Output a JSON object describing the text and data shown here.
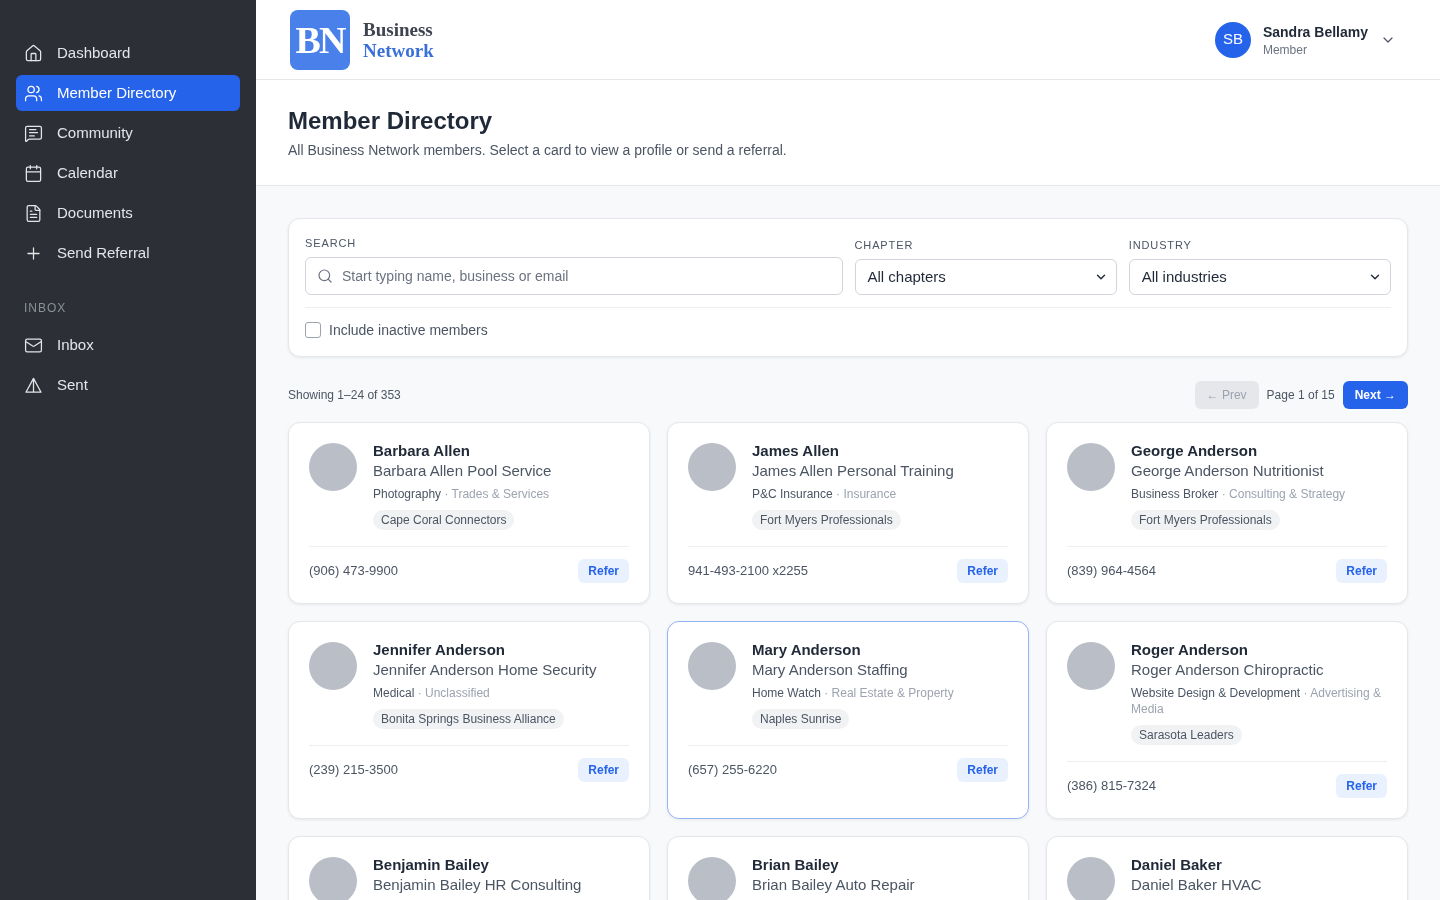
{
  "sidebar": {
    "items": [
      {
        "label": "Dashboard",
        "selected": false
      },
      {
        "label": "Member Directory",
        "selected": true
      },
      {
        "label": "Community",
        "selected": false
      },
      {
        "label": "Calendar",
        "selected": false
      },
      {
        "label": "Documents",
        "selected": false
      },
      {
        "label": "Send Referral",
        "selected": false
      }
    ],
    "section": {
      "label": "INBOX",
      "items": [
        {
          "label": "Inbox",
          "selected": false
        },
        {
          "label": "Sent",
          "selected": false
        }
      ]
    }
  },
  "header": {
    "logo": {
      "mark": "BN",
      "line_1": "Business",
      "line_2": "Network"
    },
    "user": {
      "initials": "SB",
      "name": "Sandra Bellamy",
      "role": "Member"
    }
  },
  "page_header": {
    "title": "Member Directory",
    "subtitle": "All Business Network members. Select a card to view a profile or send a referral."
  },
  "filters": {
    "search": {
      "label": "SEARCH",
      "placeholder": "Start typing name, business or email"
    },
    "chapter": {
      "label": "CHAPTER",
      "value": "All chapters"
    },
    "industry": {
      "label": "INDUSTRY",
      "value": "All industries"
    },
    "include_inactive": {
      "label": "Include inactive members",
      "checked": false
    }
  },
  "results": {
    "summary": "Showing 1–24 of 353",
    "prev": {
      "label": "← Prev",
      "disabled": true
    },
    "page": "Page 1 of 15",
    "next": {
      "label": "Next →",
      "disabled": false
    }
  },
  "members": [
    {
      "name": "Barbara Allen",
      "business": "Barbara Allen Pool Service",
      "category": "Photography",
      "sector": "· Trades & Services",
      "chapter": "Cape Coral Connectors",
      "phone": "(906) 473-9900",
      "action": "Refer",
      "selected": false
    },
    {
      "name": "James Allen",
      "business": "James Allen Personal Training",
      "category": "P&C Insurance",
      "sector": "· Insurance",
      "chapter": "Fort Myers Professionals",
      "phone": "941-493-2100 x2255",
      "action": "Refer",
      "selected": false
    },
    {
      "name": "George Anderson",
      "business": "George Anderson Nutritionist",
      "category": "Business Broker",
      "sector": "· Consulting & Strategy",
      "chapter": "Fort Myers Professionals",
      "phone": "(839) 964-4564",
      "action": "Refer",
      "selected": false
    },
    {
      "name": "Jennifer Anderson",
      "business": "Jennifer Anderson Home Security",
      "category": "Medical",
      "sector": "· Unclassified",
      "chapter": "Bonita Springs Business Alliance",
      "phone": "(239) 215-3500",
      "action": "Refer",
      "selected": false
    },
    {
      "name": "Mary Anderson",
      "business": "Mary Anderson Staffing",
      "category": "Home Watch",
      "sector": "· Real Estate & Property",
      "chapter": "Naples Sunrise",
      "phone": "(657) 255-6220",
      "action": "Refer",
      "selected": true
    },
    {
      "name": "Roger Anderson",
      "business": "Roger Anderson Chiropractic",
      "category": "Website Design & Development",
      "sector": "· Advertising & Media",
      "chapter": "Sarasota Leaders",
      "phone": "(386) 815-7324",
      "action": "Refer",
      "selected": false
    },
    {
      "name": "Benjamin Bailey",
      "business": "Benjamin Bailey HR Consulting",
      "selected": false
    },
    {
      "name": "Brian Bailey",
      "business": "Brian Bailey Auto Repair",
      "selected": false
    },
    {
      "name": "Daniel Baker",
      "business": "Daniel Baker HVAC",
      "selected": false
    }
  ]
}
